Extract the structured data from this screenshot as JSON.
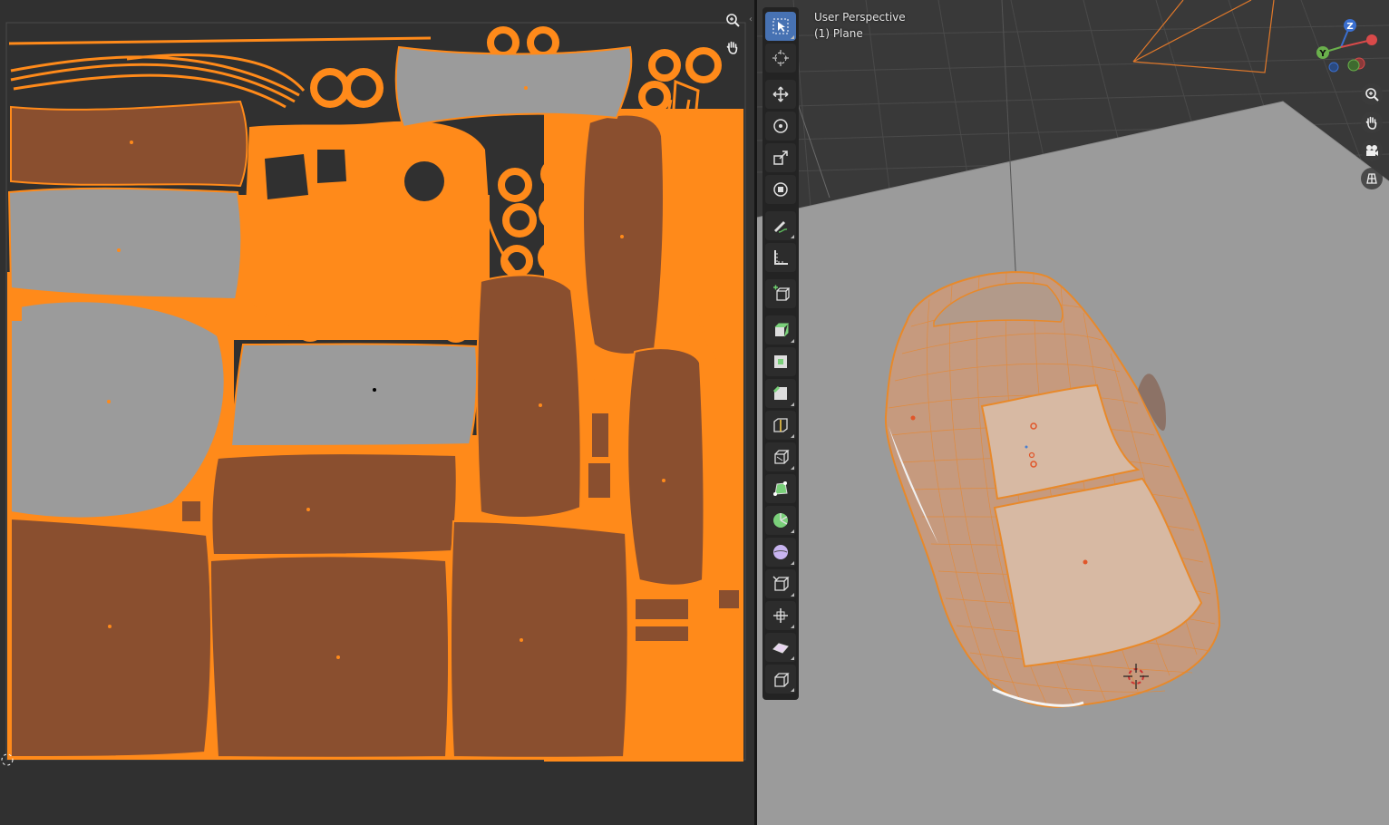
{
  "uv_editor": {
    "zoom_icon": "zoom-icon",
    "pan_icon": "hand-icon",
    "collapse_icon": "chevron-left-icon"
  },
  "viewport": {
    "view_name": "User Perspective",
    "object_name": "(1) Plane",
    "gizmo": {
      "z": "Z",
      "y": "Y"
    },
    "nav_buttons": [
      "zoom-icon",
      "hand-icon",
      "camera-icon",
      "grid-icon"
    ],
    "tools": [
      {
        "name": "select-box-icon",
        "active": true
      },
      {
        "name": "cursor-icon"
      },
      {
        "name": "move-icon"
      },
      {
        "name": "rotate-icon"
      },
      {
        "name": "scale-icon"
      },
      {
        "name": "transform-icon"
      },
      {
        "name": "annotate-icon"
      },
      {
        "name": "measure-icon"
      },
      {
        "name": "add-cube-icon"
      },
      {
        "name": "extrude-region-icon"
      },
      {
        "name": "inset-faces-icon"
      },
      {
        "name": "bevel-icon"
      },
      {
        "name": "loop-cut-icon"
      },
      {
        "name": "knife-icon"
      },
      {
        "name": "poly-build-icon"
      },
      {
        "name": "spin-icon"
      },
      {
        "name": "smooth-icon"
      },
      {
        "name": "edge-slide-icon"
      },
      {
        "name": "shrink-fatten-icon"
      },
      {
        "name": "shear-icon"
      },
      {
        "name": "rip-region-icon"
      }
    ]
  },
  "colors": {
    "uv_orange": "#ff8a1a",
    "island_brown": "#8a4f2f",
    "island_grey": "#9b9b9b",
    "active_tool": "#4772b3",
    "editor_bg": "#303030"
  }
}
